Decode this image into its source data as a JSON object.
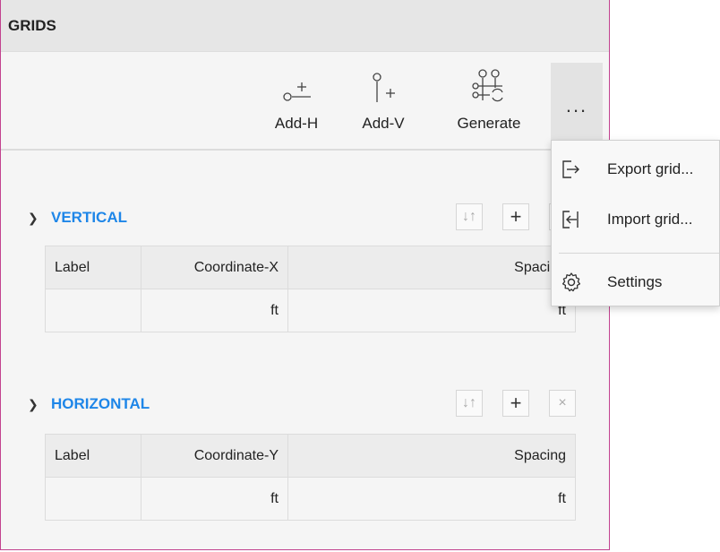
{
  "panel": {
    "title": "GRIDS"
  },
  "toolbar": {
    "add_h_label": "Add-H",
    "add_v_label": "Add-V",
    "generate_label": "Generate",
    "more_label": "..."
  },
  "vertical": {
    "title": "VERTICAL",
    "columns": [
      "Label",
      "Coordinate-X",
      "Spacing"
    ],
    "units_row": [
      "",
      "ft",
      "ft"
    ]
  },
  "horizontal": {
    "title": "HORIZONTAL",
    "columns": [
      "Label",
      "Coordinate-Y",
      "Spacing"
    ],
    "units_row": [
      "",
      "ft",
      "ft"
    ]
  },
  "menu": {
    "items": [
      {
        "label": "Export grid...",
        "icon": "export-icon"
      },
      {
        "label": "Import grid...",
        "icon": "import-icon"
      },
      {
        "label": "Settings",
        "icon": "gear-icon"
      }
    ]
  },
  "controls": {
    "sort": "↓↑",
    "add": "+",
    "remove": "×"
  },
  "colors": {
    "accent": "#1e86e8",
    "panel_border": "#c2428f"
  }
}
